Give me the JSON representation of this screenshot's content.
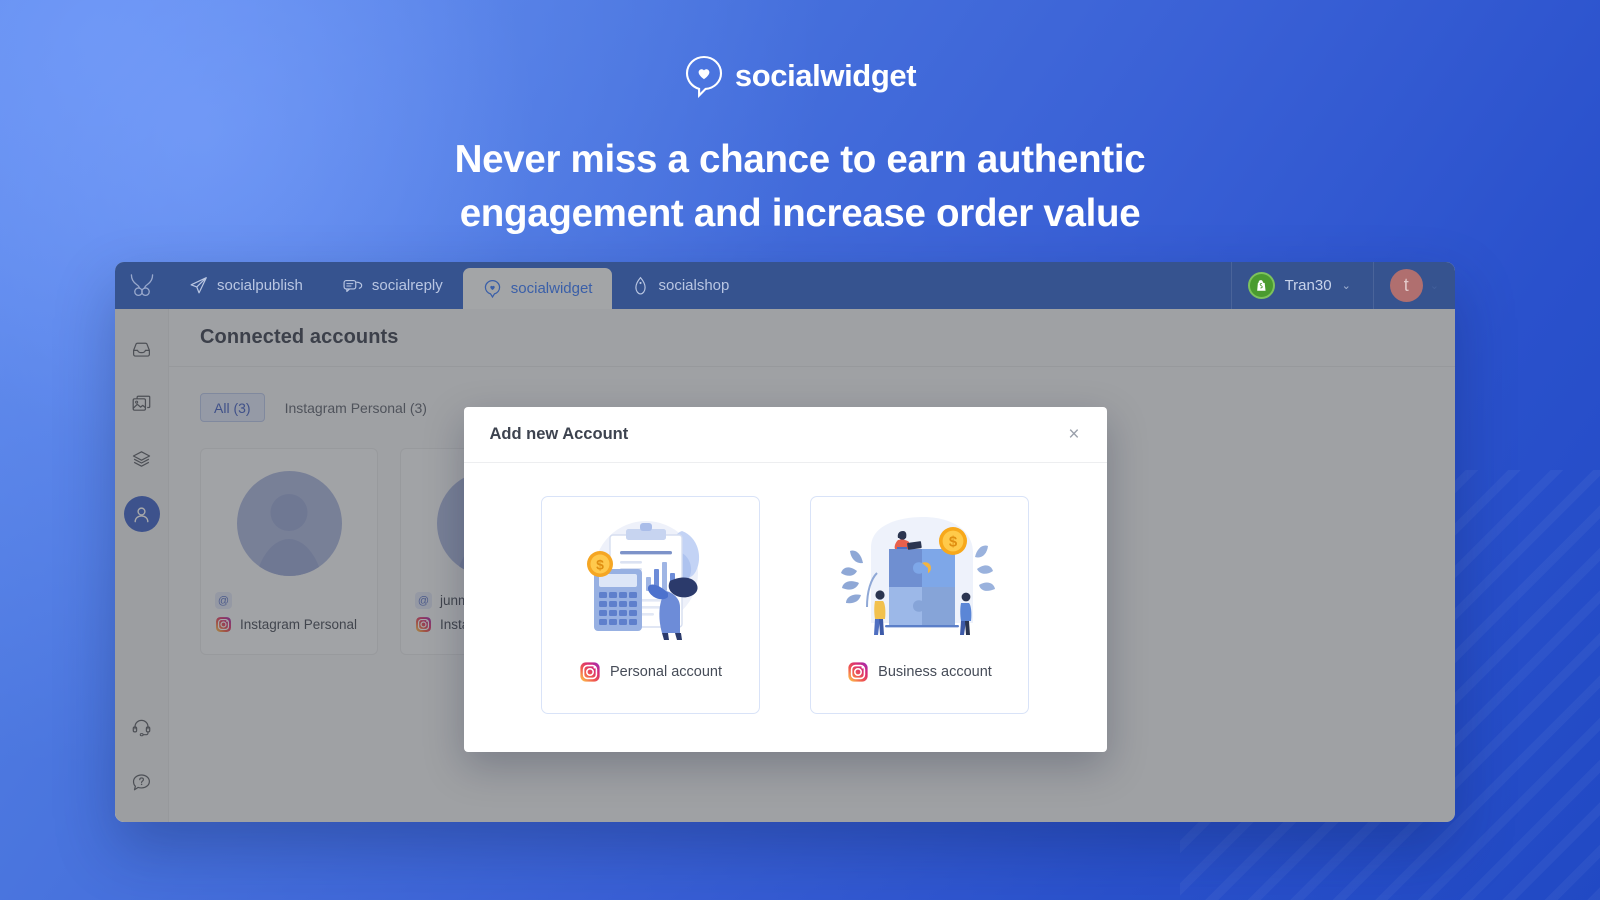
{
  "hero": {
    "brand_name": "socialwidget",
    "brand_icon": "speech-bubble-heart-icon",
    "headline": "Never miss a chance to earn authentic engagement and increase order value"
  },
  "colors": {
    "bg_from": "#5a86e8",
    "bg_to": "#2149c4",
    "nav_bg": "#36538f",
    "accent": "#3f63c8",
    "chip_active_text": "#4461c4",
    "shopify_green": "#4a9b2f",
    "avatar_bg": "#b06f6f"
  },
  "app": {
    "logo_icon": "antler-logo-icon",
    "nav_tabs": [
      {
        "label": "socialpublish",
        "icon": "paper-plane-icon",
        "active": false
      },
      {
        "label": "socialreply",
        "icon": "chat-bubbles-icon",
        "active": false
      },
      {
        "label": "socialwidget",
        "icon": "pin-heart-icon",
        "active": true
      },
      {
        "label": "socialshop",
        "icon": "price-tag-icon",
        "active": false
      }
    ],
    "store": {
      "name": "Tran30",
      "icon": "shopify-bag-icon",
      "chevron": "⌄"
    },
    "avatar": {
      "initial": "t",
      "chevron": "⌄"
    },
    "sidebar": [
      {
        "icon": "inbox-icon",
        "active": false
      },
      {
        "icon": "gallery-icon",
        "active": false
      },
      {
        "icon": "layers-icon",
        "active": false
      },
      {
        "icon": "user-icon",
        "active": true
      }
    ],
    "sidebar_bottom": [
      {
        "icon": "headset-support-icon"
      },
      {
        "icon": "question-chat-icon"
      }
    ],
    "page_title": "Connected accounts",
    "filters": [
      {
        "label": "All (3)",
        "active": true
      },
      {
        "label": "Instagram Personal (3)",
        "active": false
      }
    ],
    "accounts": [
      {
        "handle": "",
        "type": "Instagram Personal",
        "at_symbol": "@",
        "icon": "instagram-icon"
      },
      {
        "handle": "junm",
        "type": "Insta",
        "at_symbol": "@",
        "icon": "instagram-icon"
      }
    ]
  },
  "modal": {
    "title": "Add new Account",
    "close_icon": "close-icon",
    "close_label": "×",
    "options": [
      {
        "label": "Personal account",
        "icon": "instagram-icon",
        "art": "clipboard-calculator-coin-illustration"
      },
      {
        "label": "Business account",
        "icon": "instagram-icon",
        "art": "puzzle-pieces-team-illustration"
      }
    ]
  }
}
